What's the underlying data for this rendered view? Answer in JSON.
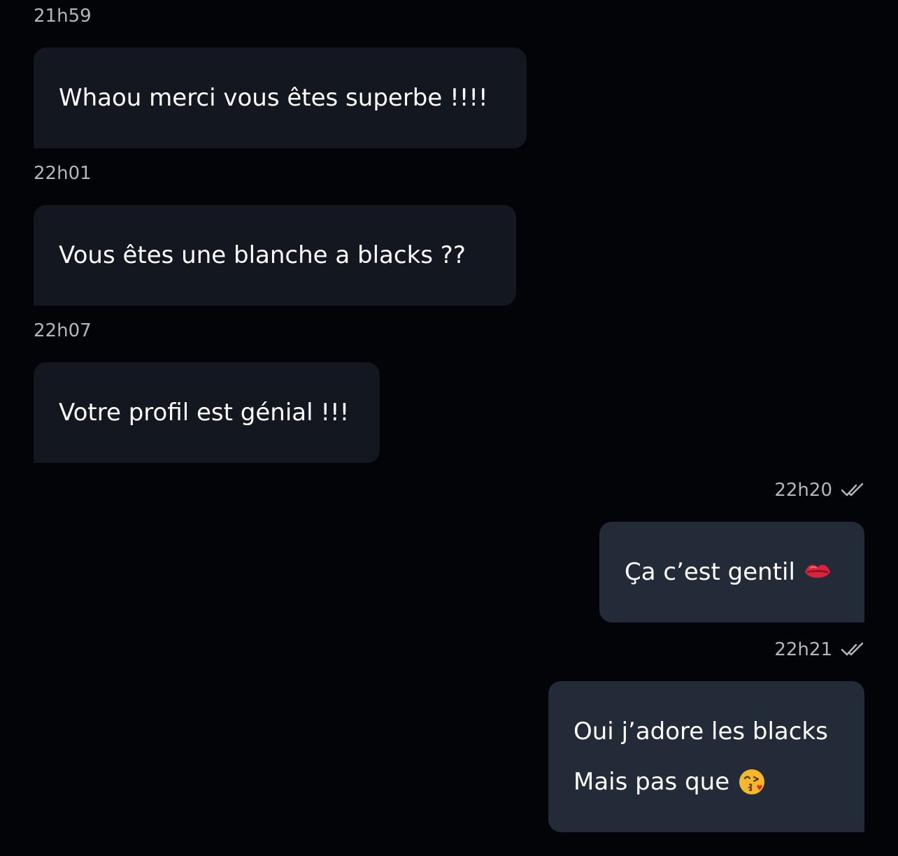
{
  "messages": [
    {
      "time": "21h59",
      "text": "Whaou merci vous êtes superbe !!!!"
    },
    {
      "time": "22h01",
      "text": "Vous êtes une blanche a blacks ??"
    },
    {
      "time": "22h07",
      "text": "Votre profil est génial !!!"
    },
    {
      "time": "22h20",
      "text": "Ça c’est gentil",
      "emoji": "kiss-mark-icon",
      "read": true
    },
    {
      "time": "22h21",
      "lines": [
        "Oui j’adore les blacks",
        "Mais pas que"
      ],
      "emoji": "face-blowing-kiss-icon",
      "read": true
    }
  ],
  "colors": {
    "background": "#030408",
    "incoming_bubble": "#131720",
    "outgoing_bubble": "#242b38",
    "timestamp": "#b3b6bd"
  }
}
